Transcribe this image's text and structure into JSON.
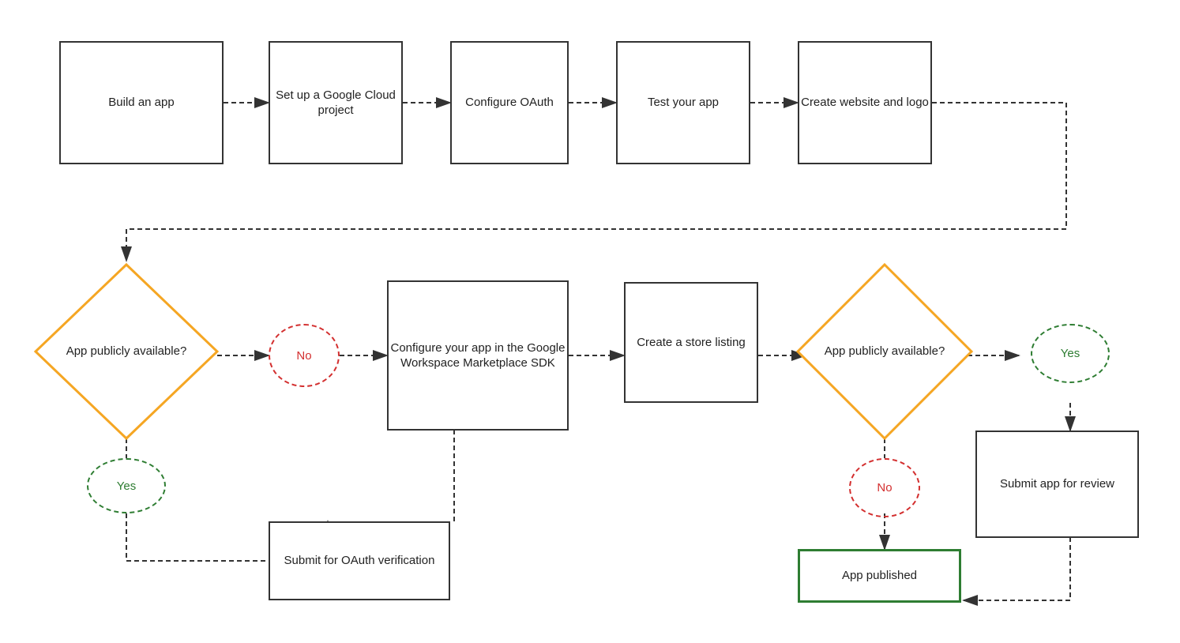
{
  "nodes": {
    "build_app": {
      "label": "Build\nan app"
    },
    "setup_gcp": {
      "label": "Set up a\nGoogle Cloud\nproject"
    },
    "configure_oauth": {
      "label": "Configure\nOAuth"
    },
    "test_app": {
      "label": "Test\nyour\napp"
    },
    "create_website": {
      "label": "Create\nwebsite\nand logo"
    },
    "app_public_1": {
      "label": "App\npublicly\navailable?"
    },
    "no_1": {
      "label": "No"
    },
    "yes_1": {
      "label": "Yes"
    },
    "configure_sdk": {
      "label": "Configure your\napp in the\nGoogle\nWorkspace\nMarketplace\nSDK"
    },
    "create_store": {
      "label": "Create a\nstore listing"
    },
    "app_public_2": {
      "label": "App\npublicly\navailable?"
    },
    "no_2": {
      "label": "No"
    },
    "yes_2": {
      "label": "Yes"
    },
    "submit_oauth": {
      "label": "Submit for\nOAuth\nverification"
    },
    "submit_review": {
      "label": "Submit app\nfor review"
    },
    "app_published": {
      "label": "App published"
    }
  }
}
